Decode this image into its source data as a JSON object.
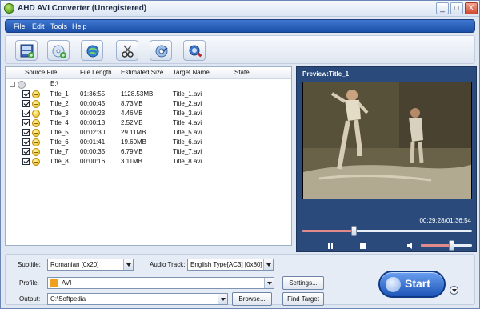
{
  "window": {
    "title": "AHD AVI Converter (Unregistered)",
    "min": "_",
    "max": "□",
    "close": "X"
  },
  "menu": [
    "File",
    "Edit",
    "Tools",
    "Help"
  ],
  "toolbar": [
    "add-video-icon",
    "add-folder-icon",
    "web-icon",
    "cut-icon",
    "settings-icon",
    "search-icon"
  ],
  "list": {
    "columns": [
      "Source File",
      "File Length",
      "Estimated Size",
      "Target Name",
      "State"
    ],
    "root": "E:\\",
    "rows": [
      {
        "name": "Title_1",
        "length": "01:36:55",
        "size": "1128.53MB",
        "target": "Title_1.avi",
        "state": ""
      },
      {
        "name": "Title_2",
        "length": "00:00:45",
        "size": "8.73MB",
        "target": "Title_2.avi",
        "state": ""
      },
      {
        "name": "Title_3",
        "length": "00:00:23",
        "size": "4.46MB",
        "target": "Title_3.avi",
        "state": ""
      },
      {
        "name": "Title_4",
        "length": "00:00:13",
        "size": "2.52MB",
        "target": "Title_4.avi",
        "state": ""
      },
      {
        "name": "Title_5",
        "length": "00:02:30",
        "size": "29.11MB",
        "target": "Title_5.avi",
        "state": ""
      },
      {
        "name": "Title_6",
        "length": "00:01:41",
        "size": "19.60MB",
        "target": "Title_6.avi",
        "state": ""
      },
      {
        "name": "Title_7",
        "length": "00:00:35",
        "size": "6.79MB",
        "target": "Title_7.avi",
        "state": ""
      },
      {
        "name": "Title_8",
        "length": "00:00:16",
        "size": "3.11MB",
        "target": "Title_8.avi",
        "state": ""
      }
    ]
  },
  "preview": {
    "title": "Preview:Title_1",
    "timecode": "00:29:28/01:36:54",
    "seek_fraction": 0.3,
    "volume_fraction": 0.6
  },
  "settings": {
    "subtitle_label": "Subtitle:",
    "subtitle_value": "Romanian [0x20]",
    "audio_label": "Audio Track:",
    "audio_value": "English Type[AC3] [0x80]",
    "profile_label": "Profile:",
    "profile_value": "AVI",
    "output_label": "Output:",
    "output_value": "C:\\Softpedia",
    "settings_button": "Settings...",
    "browse_button": "Browse...",
    "find_button": "Find Target",
    "start_button": "Start"
  },
  "colors": {
    "accent": "#1c4fa7",
    "preview_bg": "#2a4a7c"
  }
}
